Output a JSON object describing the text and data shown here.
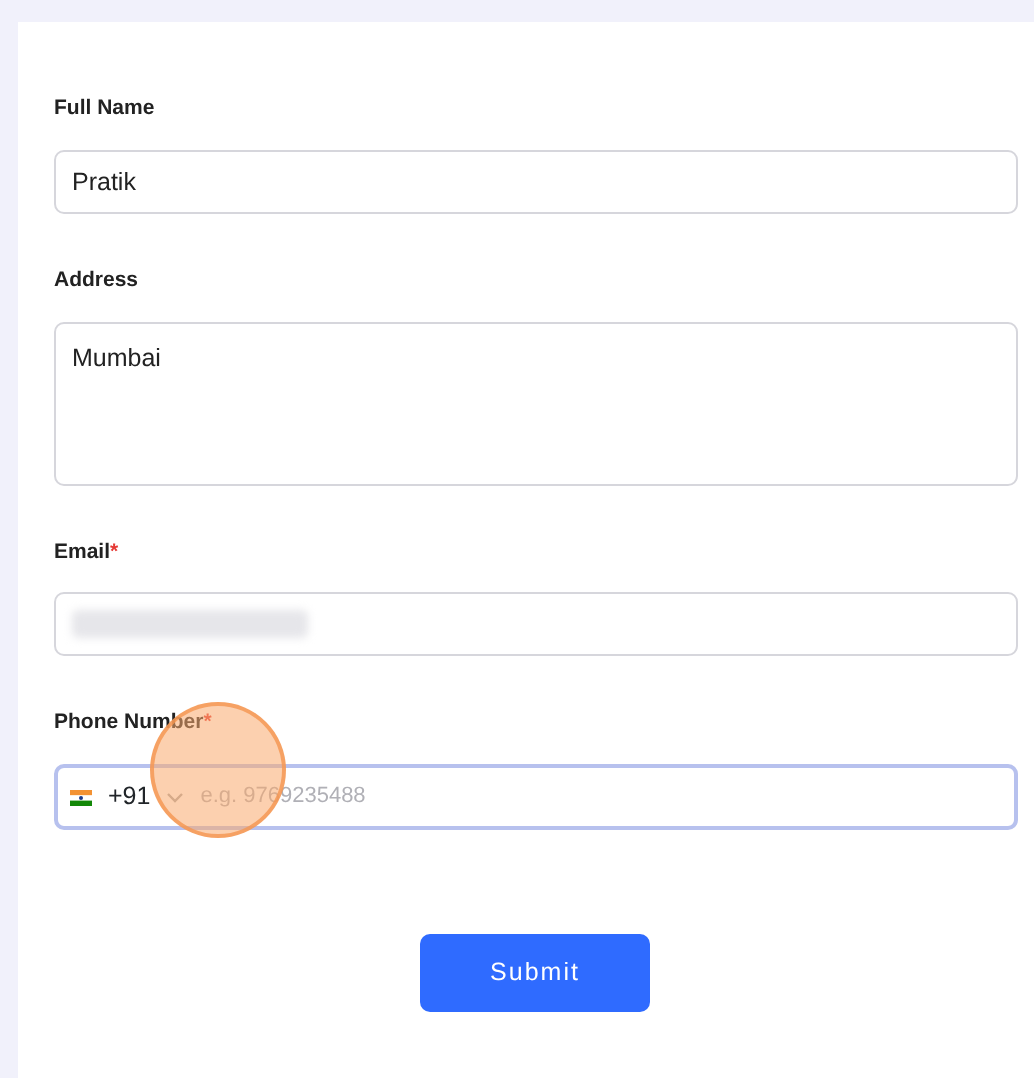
{
  "form": {
    "fields": [
      {
        "kind": "text",
        "label": "Full Name",
        "value": "Pratik",
        "focused": false
      },
      {
        "kind": "textarea",
        "label": "Address",
        "value": "Mumbai",
        "focused": false
      },
      {
        "kind": "blurred",
        "label": "Email",
        "required_mark": "*",
        "focused": false
      },
      {
        "kind": "phone",
        "label": "Phone Number",
        "required_mark": "*",
        "country_code": "+91",
        "placeholder": "e.g. 9769235488",
        "focused": true
      }
    ],
    "submit": "Submit"
  }
}
